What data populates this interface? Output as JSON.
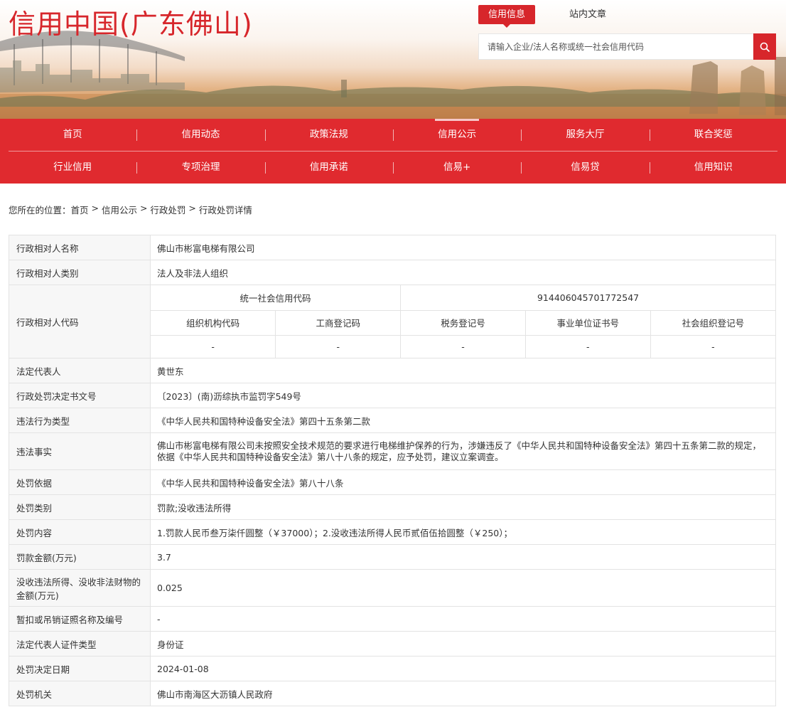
{
  "header": {
    "site_title": "信用中国(广东佛山)",
    "top_tabs": [
      "信用信息",
      "站内文章"
    ],
    "search_placeholder": "请输入企业/法人名称或统一社会信用代码",
    "search_icon": "search-icon"
  },
  "nav": {
    "row1": [
      "首页",
      "信用动态",
      "政策法规",
      "信用公示",
      "服务大厅",
      "联合奖惩"
    ],
    "row2": [
      "行业信用",
      "专项治理",
      "信用承诺",
      "信易+",
      "信易贷",
      "信用知识"
    ],
    "current": "信用公示"
  },
  "breadcrumb": {
    "prefix": "您所在的位置：",
    "items": [
      "首页",
      "信用公示",
      "行政处罚",
      "行政处罚详情"
    ],
    "separator": " > "
  },
  "detail": {
    "name_label": "行政相对人名称",
    "name_value": "佛山市彬富电梯有限公司",
    "category_label": "行政相对人类别",
    "category_value": "法人及非法人组织",
    "code_label": "行政相对人代码",
    "uscc_label": "统一社会信用代码",
    "uscc_value": "914406045701772547",
    "code_headers": [
      "组织机构代码",
      "工商登记码",
      "税务登记号",
      "事业单位证书号",
      "社会组织登记号"
    ],
    "code_values": [
      "-",
      "-",
      "-",
      "-",
      "-"
    ],
    "rows": [
      {
        "label": "法定代表人",
        "value": "黄世东"
      },
      {
        "label": "行政处罚决定书文号",
        "value": "〔2023〕(南)沥综执市监罚字549号"
      },
      {
        "label": "违法行为类型",
        "value": "《中华人民共和国特种设备安全法》第四十五条第二款"
      },
      {
        "label": "违法事实",
        "value": "佛山市彬富电梯有限公司未按照安全技术规范的要求进行电梯维护保养的行为，涉嫌违反了《中华人民共和国特种设备安全法》第四十五条第二款的规定，依据《中华人民共和国特种设备安全法》第八十八条的规定，应予处罚，建议立案调查。"
      },
      {
        "label": "处罚依据",
        "value": "《中华人民共和国特种设备安全法》第八十八条"
      },
      {
        "label": "处罚类别",
        "value": "罚款;没收违法所得"
      },
      {
        "label": "处罚内容",
        "value": "1.罚款人民币叁万柒仟圆整（￥37000）；2.没收违法所得人民币贰佰伍拾圆整（￥250）；"
      },
      {
        "label": "罚款金额(万元)",
        "value": "3.7"
      },
      {
        "label": "没收违法所得、没收非法财物的金额(万元)",
        "value": "0.025"
      },
      {
        "label": "暂扣或吊销证照名称及编号",
        "value": "-"
      },
      {
        "label": "法定代表人证件类型",
        "value": "身份证"
      },
      {
        "label": "处罚决定日期",
        "value": "2024-01-08"
      },
      {
        "label": "处罚机关",
        "value": "佛山市南海区大沥镇人民政府"
      }
    ]
  },
  "colors": {
    "brand_red": "#d7262b",
    "nav_red": "#e02a2f",
    "label_bg": "#f7f7f7",
    "border": "#e3e3e3"
  }
}
